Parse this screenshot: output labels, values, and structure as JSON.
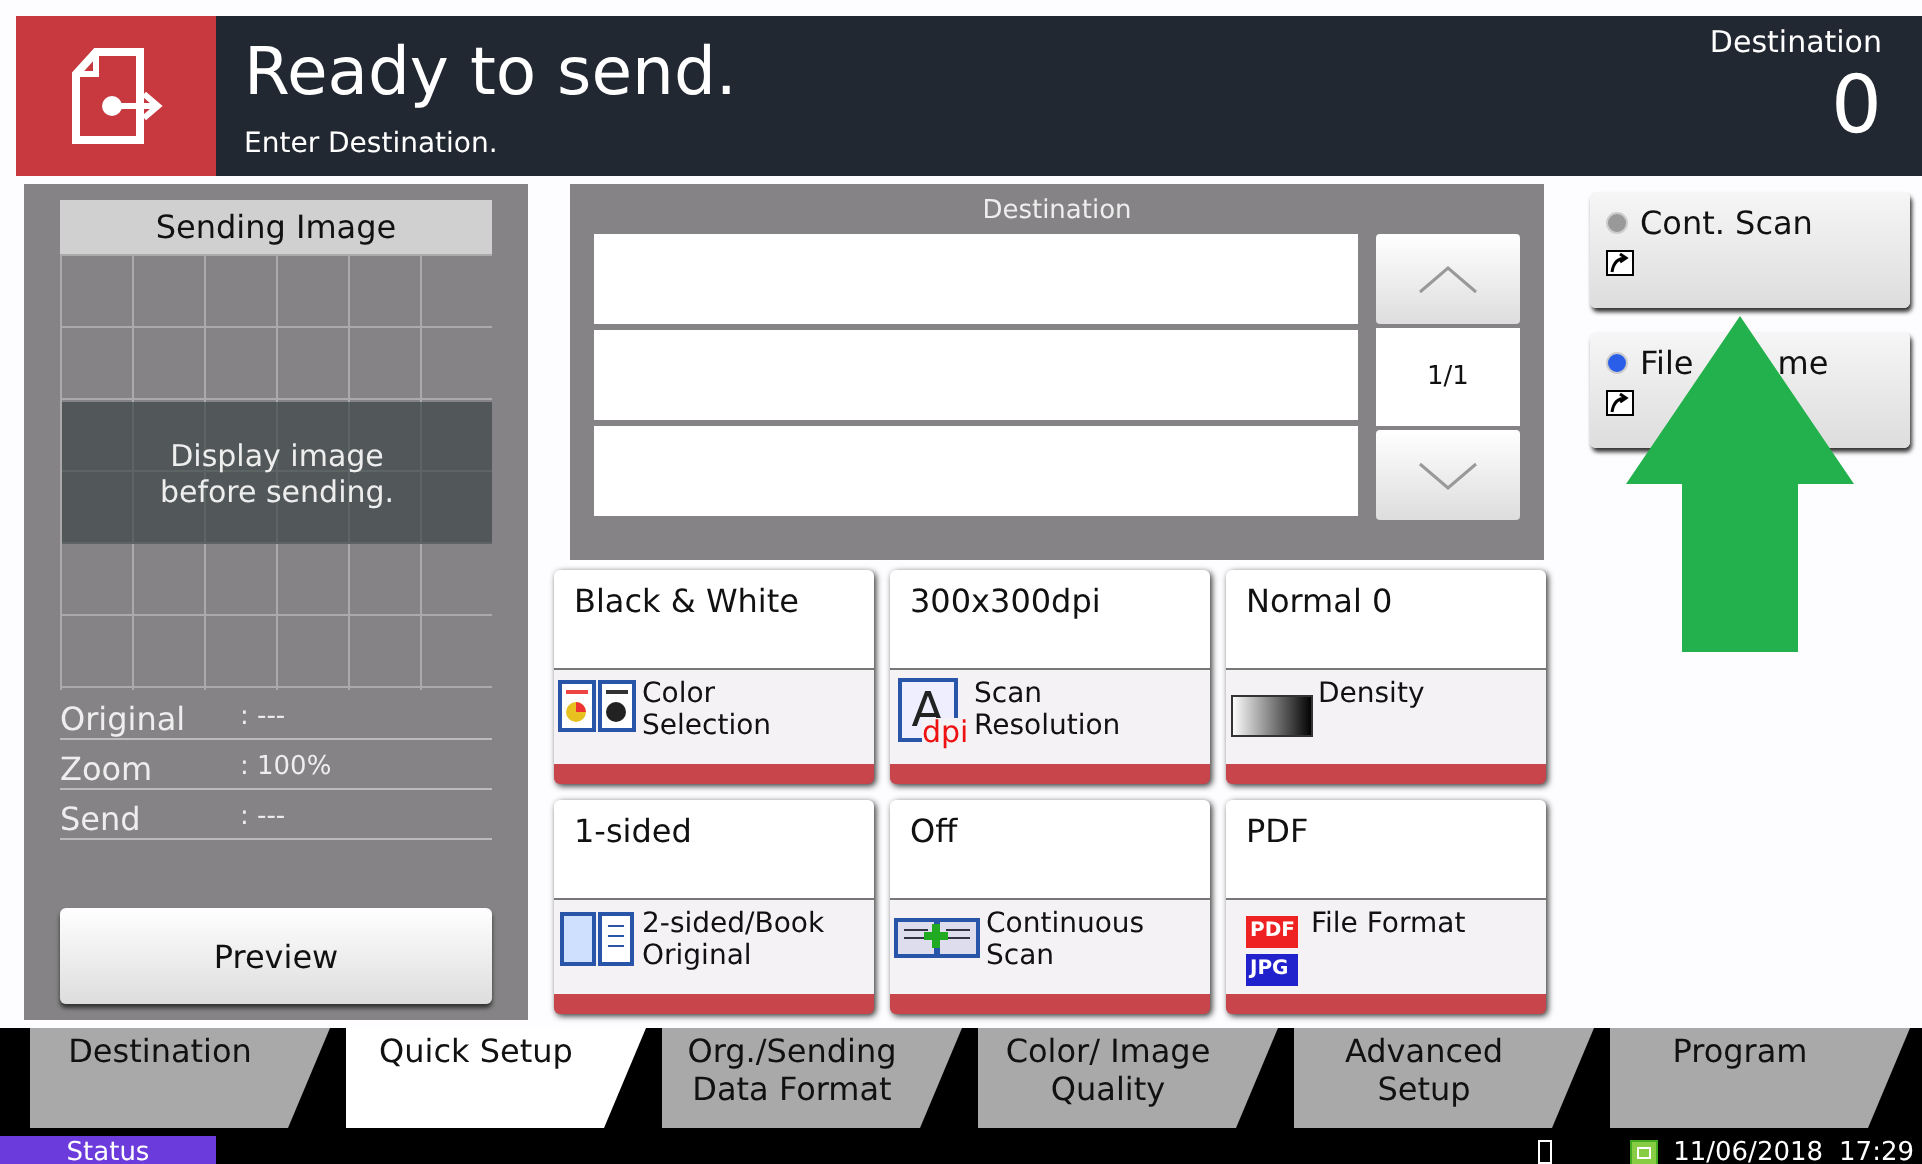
{
  "header": {
    "title": "Ready to send.",
    "subtitle": "Enter Destination.",
    "counter_label": "Destination",
    "counter": "0"
  },
  "preview": {
    "title": "Sending Image",
    "message": "Display image before sending.",
    "info": [
      {
        "label": "Original",
        "value": ": ---"
      },
      {
        "label": "Zoom",
        "value": ": 100%"
      },
      {
        "label": "Send",
        "value": ": ---"
      }
    ],
    "button": "Preview"
  },
  "destination": {
    "title": "Destination",
    "page": "1/1"
  },
  "functions": [
    {
      "setting": "Black & White",
      "name": "Color Selection",
      "kind": "color"
    },
    {
      "setting": "300x300dpi",
      "name": "Scan Resolution",
      "kind": "resolution",
      "icon_text": [
        "A",
        "dpi"
      ]
    },
    {
      "setting": "Normal 0",
      "name": "Density",
      "kind": "density"
    },
    {
      "setting": "1-sided",
      "name": "2-sided/Book Original",
      "kind": "duplex"
    },
    {
      "setting": "Off",
      "name": "Continuous Scan",
      "kind": "continuous"
    },
    {
      "setting": "PDF",
      "name": "File Format",
      "kind": "format",
      "icon_text": [
        "PDF",
        "JPG"
      ]
    }
  ],
  "side_buttons": [
    {
      "text_parts": [
        "Cont. Scan"
      ],
      "selected": false
    },
    {
      "text_parts": [
        "File",
        "me"
      ],
      "selected": true
    }
  ],
  "tabs": [
    {
      "label": "Destination",
      "selected": false
    },
    {
      "label": "Quick Setup",
      "selected": true
    },
    {
      "label": "Org./Sending Data Format",
      "selected": false
    },
    {
      "label": "Color/ Image Quality",
      "selected": false
    },
    {
      "label": "Advanced Setup",
      "selected": false
    },
    {
      "label": "Program",
      "selected": false
    }
  ],
  "status_bar": {
    "button": "Status",
    "date": "11/06/2018",
    "time": "17:29"
  }
}
